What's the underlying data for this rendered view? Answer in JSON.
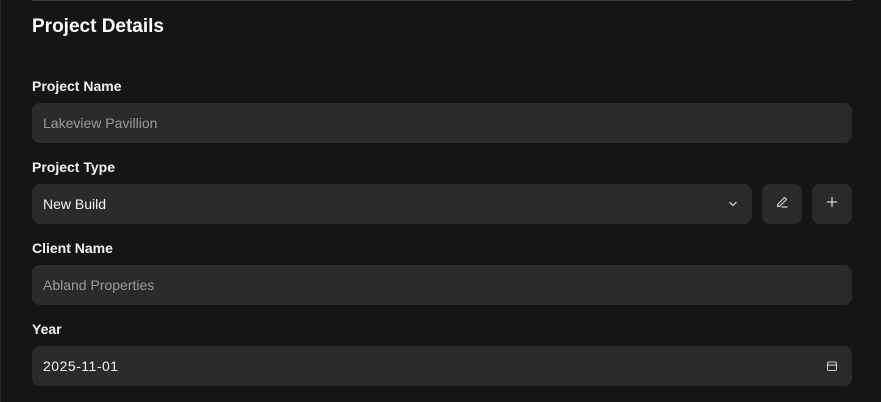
{
  "section": {
    "title": "Project Details"
  },
  "fields": {
    "project_name": {
      "label": "Project Name",
      "value": "Lakeview Pavillion"
    },
    "project_type": {
      "label": "Project Type",
      "value": "New Build",
      "icons": {
        "dropdown": "chevron-down-icon",
        "edit": "edit-pencil-icon",
        "add": "plus-icon"
      }
    },
    "client_name": {
      "label": "Client Name",
      "value": "Abland Properties"
    },
    "year": {
      "label": "Year",
      "value": "2025-11-01",
      "icon": "calendar-icon"
    }
  },
  "colors": {
    "background": "#151515",
    "field_background": "#2b2b2b",
    "text": "#ffffff",
    "muted_text": "#9a9a9a"
  }
}
